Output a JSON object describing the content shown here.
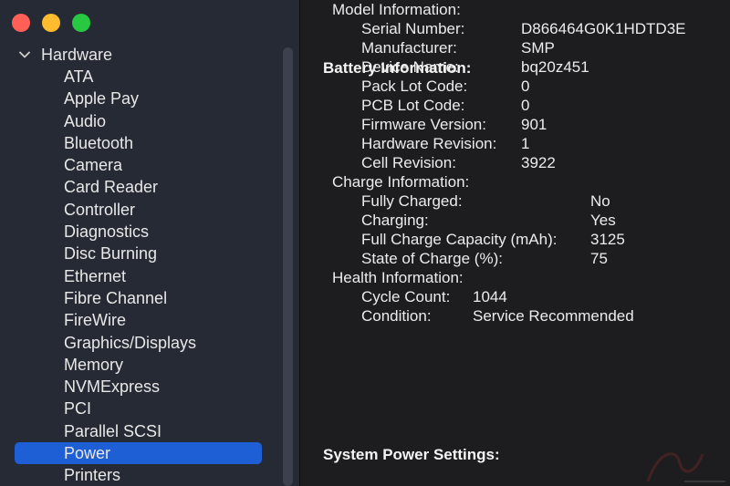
{
  "sidebar": {
    "group_label": "Hardware",
    "items": [
      "ATA",
      "Apple Pay",
      "Audio",
      "Bluetooth",
      "Camera",
      "Card Reader",
      "Controller",
      "Diagnostics",
      "Disc Burning",
      "Ethernet",
      "Fibre Channel",
      "FireWire",
      "Graphics/Displays",
      "Memory",
      "NVMExpress",
      "PCI",
      "Parallel SCSI",
      "Power",
      "Printers"
    ],
    "selected": "Power"
  },
  "content": {
    "battery_title": "Battery Information:",
    "model_header": "Model Information:",
    "model": [
      {
        "label": "Serial Number:",
        "value": "D866464G0K1HDTD3E"
      },
      {
        "label": "Manufacturer:",
        "value": "SMP"
      },
      {
        "label": "Device Name:",
        "value": "bq20z451"
      },
      {
        "label": "Pack Lot Code:",
        "value": "0"
      },
      {
        "label": "PCB Lot Code:",
        "value": "0"
      },
      {
        "label": "Firmware Version:",
        "value": "901"
      },
      {
        "label": "Hardware Revision:",
        "value": "1"
      },
      {
        "label": "Cell Revision:",
        "value": "3922"
      }
    ],
    "charge_header": "Charge Information:",
    "charge": [
      {
        "label": "Fully Charged:",
        "value": "No"
      },
      {
        "label": "Charging:",
        "value": "Yes"
      },
      {
        "label": "Full Charge Capacity (mAh):",
        "value": "3125"
      },
      {
        "label": "State of Charge (%):",
        "value": "75"
      }
    ],
    "health_header": "Health Information:",
    "health": [
      {
        "label": "Cycle Count:",
        "value": "1044"
      },
      {
        "label": "Condition:",
        "value": "Service Recommended"
      }
    ],
    "power_title": "System Power Settings:"
  }
}
